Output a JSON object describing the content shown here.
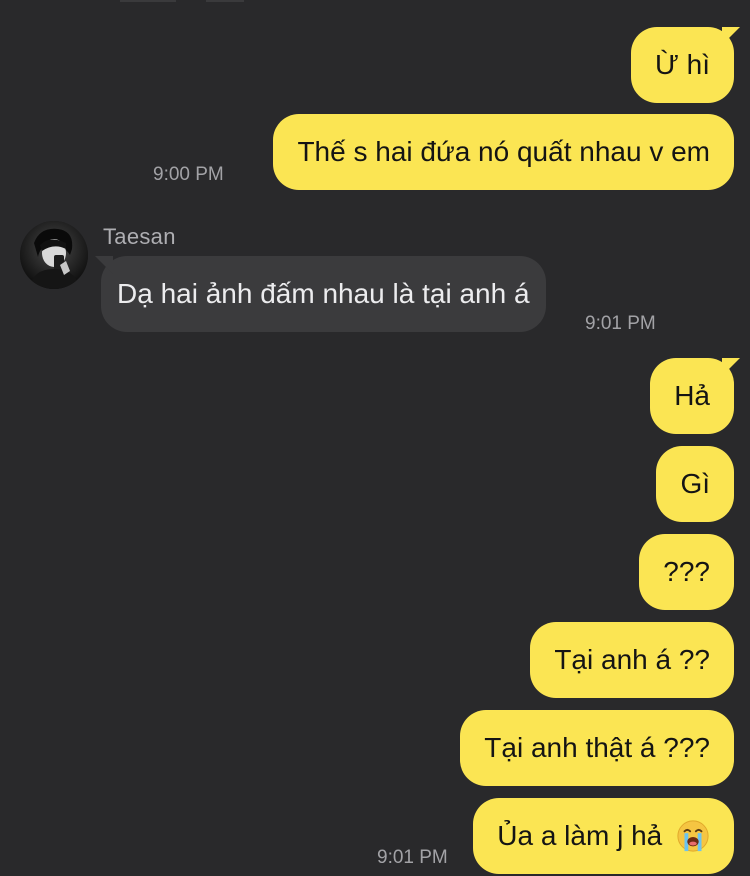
{
  "conversation": {
    "contact_name": "Taesan",
    "messages": [
      {
        "id": "m1",
        "direction": "out",
        "text": "Ừ hì"
      },
      {
        "id": "m2",
        "direction": "out",
        "text": "Thế s hai đứa nó quất nhau v em",
        "time": "9:00 PM"
      },
      {
        "id": "m3",
        "direction": "in",
        "sender": "Taesan",
        "text": "Dạ hai ảnh đấm nhau là tại anh á",
        "time": "9:01 PM"
      },
      {
        "id": "m4",
        "direction": "out",
        "text": "Hả"
      },
      {
        "id": "m5",
        "direction": "out",
        "text": "Gì"
      },
      {
        "id": "m6",
        "direction": "out",
        "text": "???"
      },
      {
        "id": "m7",
        "direction": "out",
        "text": "Tại anh á ??"
      },
      {
        "id": "m8",
        "direction": "out",
        "text": "Tại anh thật á ???"
      },
      {
        "id": "m9",
        "direction": "out",
        "text": "Ủa a làm j hả",
        "emoji": "loudly-crying-face-emoji",
        "time": "9:01 PM"
      }
    ]
  },
  "colors": {
    "background": "#29292b",
    "outgoing_bubble": "#fbe553",
    "incoming_bubble": "#3b3b3d",
    "timestamp": "#a2a2a6"
  }
}
